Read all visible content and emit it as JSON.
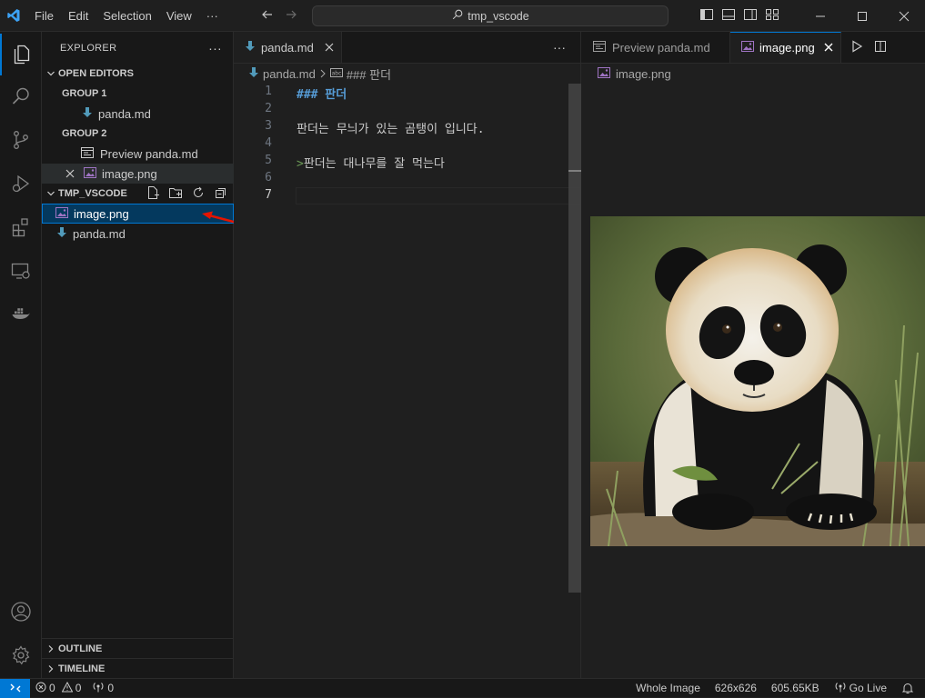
{
  "menu": [
    "File",
    "Edit",
    "Selection",
    "View",
    "···"
  ],
  "search": {
    "text": "tmp_vscode"
  },
  "sidebar": {
    "title": "EXPLORER",
    "more": "···",
    "open_editors": {
      "title": "OPEN EDITORS",
      "group1": "GROUP 1",
      "group1_items": [
        "panda.md"
      ],
      "group2": "GROUP 2",
      "group2_items": [
        "Preview panda.md",
        "image.png"
      ]
    },
    "workspace": {
      "title": "TMP_VSCODE",
      "files": [
        "image.png",
        "panda.md"
      ]
    },
    "outline": "OUTLINE",
    "timeline": "TIMELINE"
  },
  "editor1": {
    "tab_label": "panda.md",
    "breadcrumb_file": "panda.md",
    "breadcrumb_symbol": "### 판더",
    "line_numbers": [
      "1",
      "2",
      "3",
      "4",
      "5",
      "6",
      "7"
    ],
    "lines": {
      "l1": "### 판더",
      "l3": "판더는 무늬가 있는 곰탱이 입니다.",
      "l5_marker": ">",
      "l5_text": "판더는 대나무를 잘 먹는다"
    }
  },
  "editor2": {
    "tab_preview": "Preview panda.md",
    "tab_image": "image.png",
    "breadcrumb": "image.png"
  },
  "statusbar": {
    "errors": "0",
    "warnings": "0",
    "ports": "0",
    "whole_image": "Whole Image",
    "dimensions": "626x626",
    "size": "605.65KB",
    "go_live": "Go Live"
  },
  "colors": {
    "accent": "#0078d4",
    "md_icon": "#519aba",
    "image_icon": "#a074c4",
    "heading": "#569cd6",
    "quote": "#6a9955",
    "annotation_arrow": "#e51400"
  }
}
